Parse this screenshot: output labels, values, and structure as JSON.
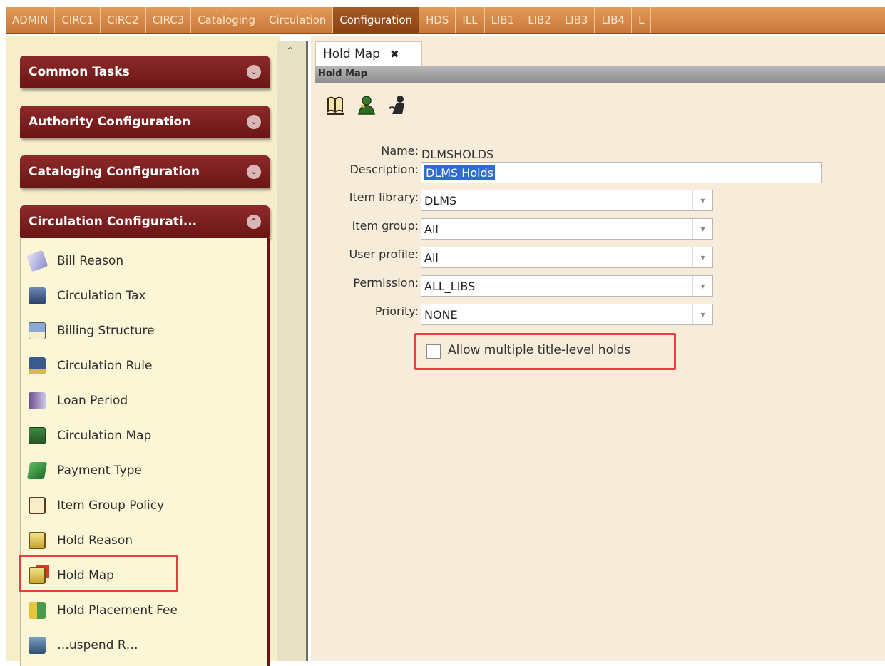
{
  "top_tabs": [
    "ADMIN",
    "CIRC1",
    "CIRC2",
    "CIRC3",
    "Cataloging",
    "Circulation",
    "Configuration",
    "HDS",
    "ILL",
    "LIB1",
    "LIB2",
    "LIB3",
    "LIB4",
    "L"
  ],
  "active_tab": "Configuration",
  "sidebar": {
    "groups": [
      {
        "label": "Common Tasks"
      },
      {
        "label": "Authority Configuration"
      },
      {
        "label": "Cataloging Configuration"
      },
      {
        "label": "Circulation Configurati..."
      }
    ],
    "items": [
      {
        "label": "Bill Reason",
        "icon": "bill-reason-icon"
      },
      {
        "label": "Circulation Tax",
        "icon": "circulation-tax-icon"
      },
      {
        "label": "Billing Structure",
        "icon": "billing-structure-icon"
      },
      {
        "label": "Circulation Rule",
        "icon": "circulation-rule-icon"
      },
      {
        "label": "Loan Period",
        "icon": "loan-period-icon"
      },
      {
        "label": "Circulation Map",
        "icon": "circulation-map-icon"
      },
      {
        "label": "Payment Type",
        "icon": "payment-type-icon"
      },
      {
        "label": "Item Group Policy",
        "icon": "item-group-policy-icon"
      },
      {
        "label": "Hold Reason",
        "icon": "hold-reason-icon"
      },
      {
        "label": "Hold Map",
        "icon": "hold-map-icon"
      },
      {
        "label": "Hold Placement Fee",
        "icon": "hold-placement-fee-icon"
      },
      {
        "label": "…uspend R…",
        "icon": "suspend-icon"
      }
    ]
  },
  "content": {
    "tab_label": "Hold Map",
    "tab_close": "✖",
    "title_strip": "Hold Map",
    "form": {
      "name_label": "Name:",
      "name_value": "DLMSHOLDS",
      "description_label": "Description:",
      "description_value": "DLMS Holds",
      "item_library_label": "Item library:",
      "item_library_value": "DLMS",
      "item_group_label": "Item group:",
      "item_group_value": "All",
      "user_profile_label": "User profile:",
      "user_profile_value": "All",
      "permission_label": "Permission:",
      "permission_value": "ALL_LIBS",
      "priority_label": "Priority:",
      "priority_value": "NONE",
      "multiple_holds_label": "Allow multiple title-level holds",
      "multiple_holds_checked": false
    }
  },
  "colors": {
    "topbar": "#c8783a",
    "group_header": "#6a1515",
    "sidebar_bg": "#fbf6d6",
    "content_bg": "#f6ecd9",
    "highlight": "#e2413f",
    "selection": "#2f6cd1"
  }
}
